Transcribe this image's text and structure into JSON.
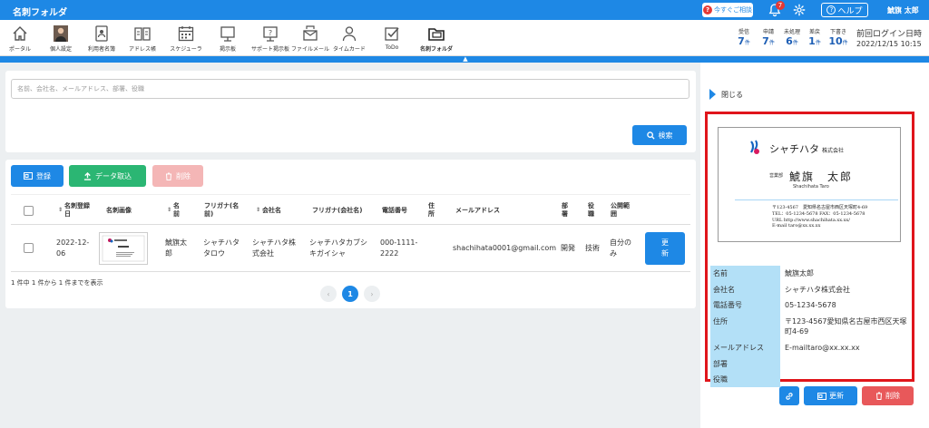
{
  "app": {
    "title": "名刺フォルダ"
  },
  "topbar": {
    "consult_label": "今すぐご相談",
    "notification_count": "7",
    "help_label": "ヘルプ",
    "user_name": "鯱旗 太郎"
  },
  "nav": {
    "items": [
      {
        "label": "ポータル",
        "icon": "home-icon"
      },
      {
        "label": "個人設定",
        "icon": "avatar-icon"
      },
      {
        "label": "利用者名簿",
        "icon": "address-book-icon"
      },
      {
        "label": "アドレス帳",
        "icon": "book-icon"
      },
      {
        "label": "スケジューラ",
        "icon": "calendar-icon"
      },
      {
        "label": "掲示板",
        "icon": "board-icon"
      },
      {
        "label": "サポート掲示板",
        "icon": "support-board-icon"
      },
      {
        "label": "ファイルメール",
        "icon": "file-mail-icon"
      },
      {
        "label": "タイムカード",
        "icon": "timecard-icon"
      },
      {
        "label": "ToDo",
        "icon": "checkbox-icon"
      },
      {
        "label": "名刺フォルダ",
        "icon": "card-folder-icon"
      }
    ],
    "stats": [
      {
        "title": "受信",
        "value": "7",
        "unit": "件"
      },
      {
        "title": "申請",
        "value": "7",
        "unit": "件"
      },
      {
        "title": "未処理",
        "value": "6",
        "unit": "件"
      },
      {
        "title": "差戻",
        "value": "1",
        "unit": "件"
      },
      {
        "title": "下書き",
        "value": "10",
        "unit": "件"
      }
    ],
    "last_login_label": "前回ログイン日時",
    "last_login_time": "2022/12/15 10:15"
  },
  "search": {
    "placeholder": "名前、会社名、メールアドレス、部署、役職",
    "button_label": "検索"
  },
  "toolbar": {
    "register_label": "登録",
    "import_label": "データ取込",
    "delete_label": "削除"
  },
  "table": {
    "headers": {
      "registered_date": "名刺登録日",
      "image": "名刺画像",
      "name": "名前",
      "furigana": "フリガナ(名前)",
      "company": "会社名",
      "company_furigana": "フリガナ(会社名)",
      "phone": "電話番号",
      "address": "住所",
      "email": "メールアドレス",
      "department": "部署",
      "position": "役職",
      "visibility": "公開範囲"
    },
    "rows": [
      {
        "registered_date": "2022-12-06",
        "name": "鯱旗太郎",
        "furigana": "シャチハタタロウ",
        "company": "シャチハタ株式会社",
        "company_furigana": "シャチハタカブシキガイシャ",
        "phone": "000-1111-2222",
        "address": "",
        "email": "shachihata0001@gmail.com",
        "department": "開発",
        "position": "技術",
        "visibility": "自分のみ",
        "update_label": "更新"
      }
    ],
    "count_text": "1 件中 1 件から 1 件までを表示",
    "current_page": "1"
  },
  "detail": {
    "close_label": "閉じる",
    "card": {
      "company": "シャチハタ",
      "company_suffix": "株式会社",
      "department": "営業部",
      "name": "鯱旗　太郎",
      "roman": "Shachihata Taro",
      "address": "〒123-4567　愛知県名古屋市西区天塚町4-69",
      "tel_fax": "TEL：05-1234-5678 FAX：05-1234-5678",
      "url": "URL http://www.shachihata.xx.xx/",
      "email": "E-mail taro@xx.xx.xx"
    },
    "fields": [
      {
        "label": "名前",
        "value": "鯱旗太郎"
      },
      {
        "label": "会社名",
        "value": "シャチハタ株式会社"
      },
      {
        "label": "電話番号",
        "value": "05-1234-5678"
      },
      {
        "label": "住所",
        "value": "〒123-4567愛知県名古屋市西区天塚町4-69"
      },
      {
        "label": "メールアドレス",
        "value": "E-mailtaro@xx.xx.xx"
      },
      {
        "label": "部署",
        "value": ""
      },
      {
        "label": "役職",
        "value": ""
      }
    ],
    "update_label": "更新",
    "delete_label": "削除"
  },
  "colors": {
    "primary": "#1e88e5",
    "success": "#2bb673",
    "danger": "#e8585a",
    "highlight_frame": "#e0151b",
    "label_bg": "#b3e0f7"
  }
}
